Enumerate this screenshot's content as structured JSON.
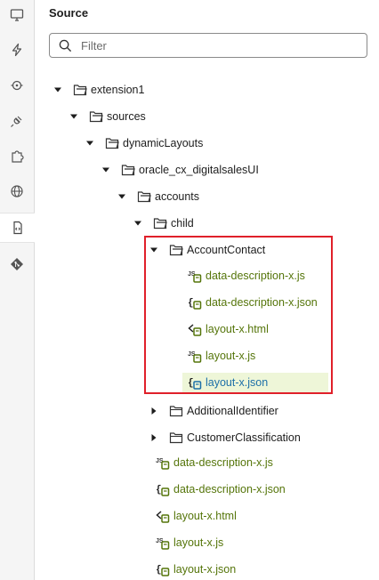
{
  "panel": {
    "title": "Source"
  },
  "filter": {
    "placeholder": "Filter"
  },
  "rail": {
    "items": [
      {
        "icon": "monitor-icon"
      },
      {
        "icon": "lightning-icon"
      },
      {
        "icon": "event-icon"
      },
      {
        "icon": "plug-icon"
      },
      {
        "icon": "extension-puzzle-icon"
      },
      {
        "icon": "globe-icon"
      },
      {
        "icon": "source-code-icon",
        "active": true
      },
      {
        "icon": "git-icon"
      }
    ]
  },
  "tree": {
    "extension1": "extension1",
    "sources": "sources",
    "dynamicLayouts": "dynamicLayouts",
    "oracle_cx": "oracle_cx_digitalsalesUI",
    "accounts": "accounts",
    "child": "child",
    "accountContact": "AccountContact",
    "ac_files": [
      "data-description-x.js",
      "data-description-x.json",
      "layout-x.html",
      "layout-x.js",
      "layout-x.json"
    ],
    "additionalIdentifier": "AdditionalIdentifier",
    "customerClassification": "CustomerClassification",
    "child_files": [
      "data-description-x.js",
      "data-description-x.json",
      "layout-x.html",
      "layout-x.js",
      "layout-x.json"
    ]
  },
  "colors": {
    "accent_green": "#55750a",
    "selected_blue": "#1c6fa8",
    "highlight_red": "#e0202a"
  }
}
